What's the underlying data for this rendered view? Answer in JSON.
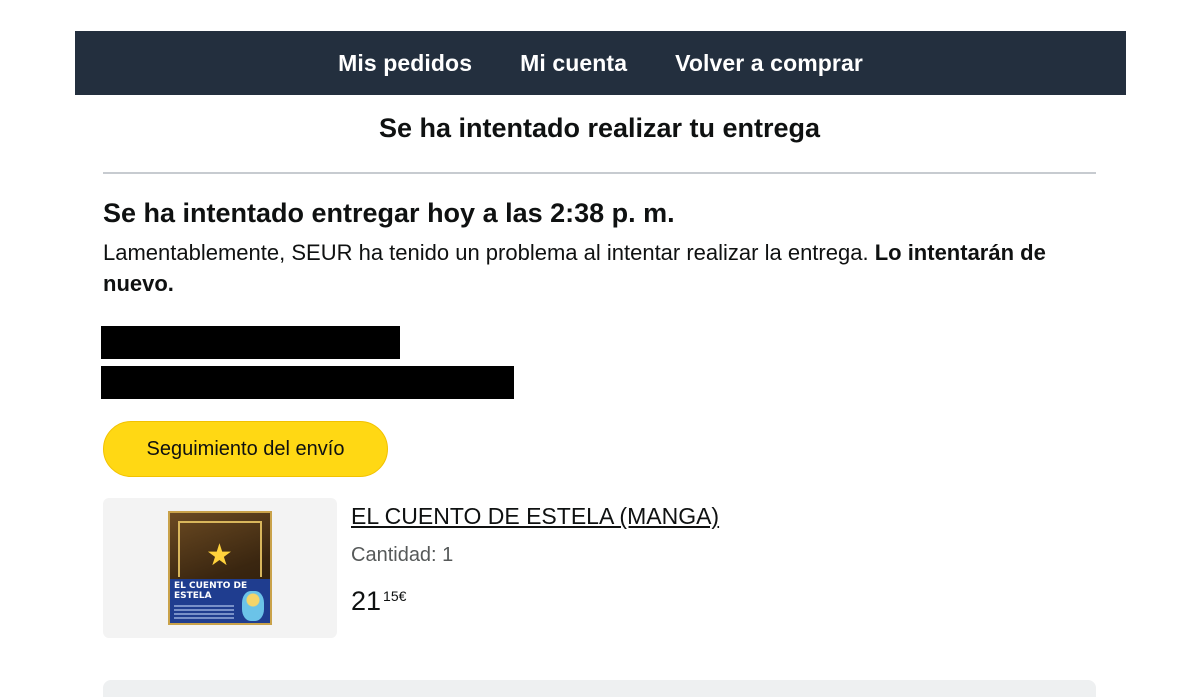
{
  "nav": {
    "items": [
      "Mis pedidos",
      "Mi cuenta",
      "Volver a comprar"
    ]
  },
  "header": {
    "title": "Se ha intentado realizar tu entrega"
  },
  "delivery": {
    "heading": "Se ha intentado entregar hoy a las 2:38 p. m.",
    "message": "Lamentablemente, SEUR ha tenido un problema al intentar realizar la entrega.",
    "message_bold": "Lo intentarán de nuevo."
  },
  "actions": {
    "track_label": "Seguimiento del envío"
  },
  "product": {
    "title": "EL CUENTO DE ESTELA (MANGA)",
    "quantity": "Cantidad: 1",
    "price_whole": "21",
    "price_fraction": "15€",
    "cover_text": "EL CUENTO DE ESTELA"
  },
  "colors": {
    "nav_bg": "#232f3e",
    "button_bg": "#ffd814"
  }
}
